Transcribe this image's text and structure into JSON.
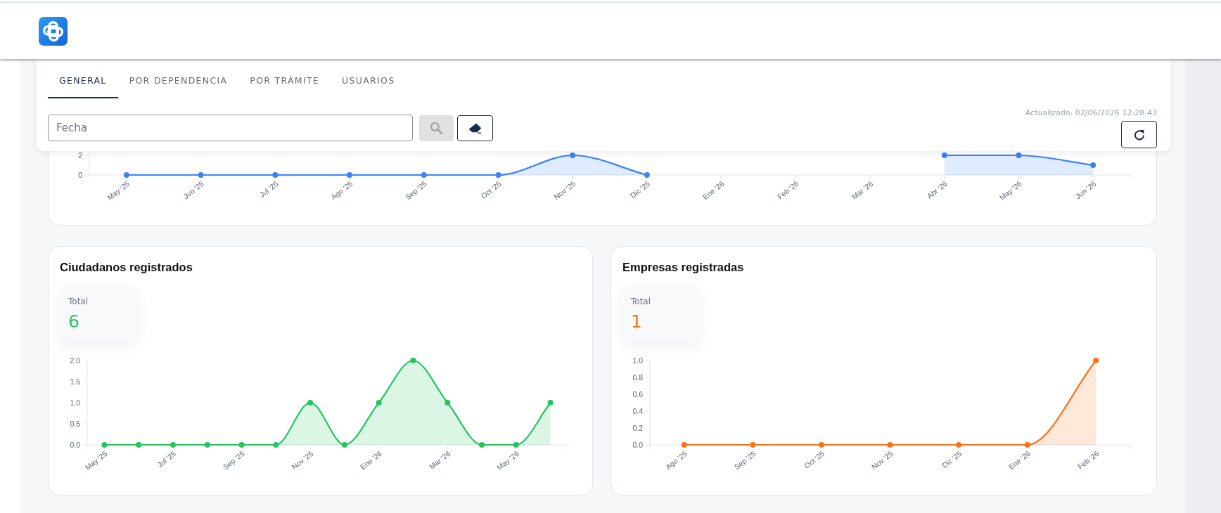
{
  "tabs": [
    {
      "label": "GENERAL",
      "selected": true
    },
    {
      "label": "POR DEPENDENCIA",
      "selected": false
    },
    {
      "label": "POR TRÁMITE",
      "selected": false
    },
    {
      "label": "USUARIOS",
      "selected": false
    }
  ],
  "filter": {
    "date_field": {
      "placeholder": "Fecha"
    },
    "buttons": [
      {
        "kind": "search",
        "disabled": true
      },
      {
        "kind": "clear",
        "disabled": false
      }
    ],
    "updated_text": "Actualizado: 02/06/2026 12:28:43"
  },
  "chart_cards": [
    {
      "kind": "timeline",
      "chart_data": {
        "type": "area",
        "categories": [
          "May '25",
          "Jun '25",
          "Jul '25",
          "Ago '25",
          "Sep '25",
          "Oct '25",
          "Nov '25",
          "Dic '25",
          "Ene '26",
          "Feb '26",
          "Mar '26",
          "Abr '26",
          "May '26",
          "Jun '26"
        ],
        "ylim": [
          0,
          2
        ],
        "yticks": [
          0,
          2
        ],
        "series": [
          {
            "color": "#3b82f6",
            "values": [
              0,
              0,
              0,
              0,
              0,
              0,
              2,
              0,
              null,
              null,
              null,
              2,
              2,
              1
            ]
          }
        ]
      }
    },
    {
      "kind": "total",
      "title": "Ciudadanos registrados",
      "total_label": "Total",
      "total_value": "6",
      "color": "#22c55e",
      "chart_data": {
        "type": "area",
        "categories": [
          "May '25",
          null,
          "Jul '25",
          null,
          "Sep '25",
          null,
          "Nov '25",
          null,
          "Ene '26",
          null,
          "Mar '26",
          null,
          "May '26",
          null
        ],
        "ylim": [
          0,
          2
        ],
        "yticks": [
          {
            "value": 0,
            "label": "0.0"
          },
          {
            "value": 0.5,
            "label": "0.5"
          },
          {
            "value": 1,
            "label": "1.0"
          },
          {
            "value": 1.5,
            "label": "1.5"
          },
          {
            "value": 2,
            "label": "2.0"
          }
        ],
        "series": [
          {
            "color": "#22c55e",
            "values": [
              0,
              0,
              0,
              0,
              0,
              0,
              1,
              0,
              1,
              2,
              1,
              0,
              0,
              1
            ]
          }
        ]
      }
    },
    {
      "kind": "total",
      "title": "Empresas registradas",
      "total_label": "Total",
      "total_value": "1",
      "color": "#f97316",
      "chart_data": {
        "type": "area",
        "categories": [
          "Ago '25",
          "Sep '25",
          "Oct '25",
          "Nov '25",
          "Dic '25",
          "Ene '26",
          "Feb '26"
        ],
        "ylim": [
          0,
          1
        ],
        "yticks": [
          {
            "value": 0,
            "label": "0.0"
          },
          {
            "value": 0.2,
            "label": "0.2"
          },
          {
            "value": 0.4,
            "label": "0.4"
          },
          {
            "value": 0.6,
            "label": "0.6"
          },
          {
            "value": 0.8,
            "label": "0.8"
          },
          {
            "value": 1,
            "label": "1.0"
          }
        ],
        "series": [
          {
            "color": "#f97316",
            "values": [
              0,
              0,
              0,
              0,
              0,
              0,
              1
            ]
          }
        ]
      }
    }
  ]
}
